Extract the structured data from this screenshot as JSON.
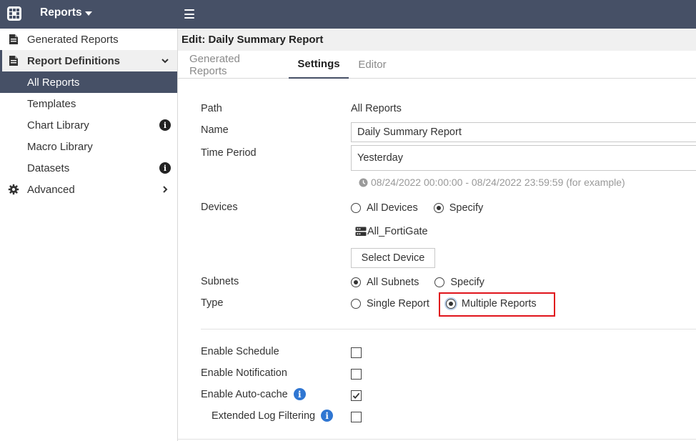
{
  "topbar": {
    "app_icon": "apps-grid-icon",
    "title": "Reports",
    "menu_icon": "hamburger-icon"
  },
  "sidebar": {
    "items": [
      {
        "label": "Generated Reports",
        "icon": "document-icon"
      },
      {
        "label": "Report Definitions",
        "icon": "document-icon",
        "expanded": true
      },
      {
        "label": "All Reports",
        "selected": true
      },
      {
        "label": "Templates"
      },
      {
        "label": "Chart Library",
        "badge": "info-icon"
      },
      {
        "label": "Macro Library"
      },
      {
        "label": "Datasets",
        "badge": "info-icon"
      },
      {
        "label": "Advanced",
        "icon": "gear-icon"
      }
    ]
  },
  "main": {
    "header": "Edit: Daily Summary Report",
    "tabs": [
      {
        "label": "Generated Reports"
      },
      {
        "label": "Settings",
        "active": true
      },
      {
        "label": "Editor"
      }
    ]
  },
  "form": {
    "path_label": "Path",
    "path_value": "All Reports",
    "name_label": "Name",
    "name_value": "Daily Summary Report",
    "time_period_label": "Time Period",
    "time_period_value": "Yesterday",
    "time_hint": "08/24/2022 00:00:00 - 08/24/2022 23:59:59 (for example)",
    "devices_label": "Devices",
    "devices_options": [
      "All Devices",
      "Specify"
    ],
    "devices_selected": "Specify",
    "device_chip": "All_FortiGate",
    "select_device_label": "Select Device",
    "subnets_label": "Subnets",
    "subnets_options": [
      "All Subnets",
      "Specify"
    ],
    "subnets_selected": "All Subnets",
    "type_label": "Type",
    "type_options": [
      "Single Report",
      "Multiple Reports"
    ],
    "type_selected": "Multiple Reports",
    "enable_schedule_label": "Enable Schedule",
    "enable_schedule": false,
    "enable_notification_label": "Enable Notification",
    "enable_notification": false,
    "enable_autocache_label": "Enable Auto-cache",
    "enable_autocache": true,
    "extended_log_label": "Extended Log Filtering",
    "extended_log": false
  },
  "colors": {
    "topbar": "#465066",
    "selected_nav": "#465066",
    "highlight": "#e0141b",
    "info_blue": "#2f76d2"
  }
}
